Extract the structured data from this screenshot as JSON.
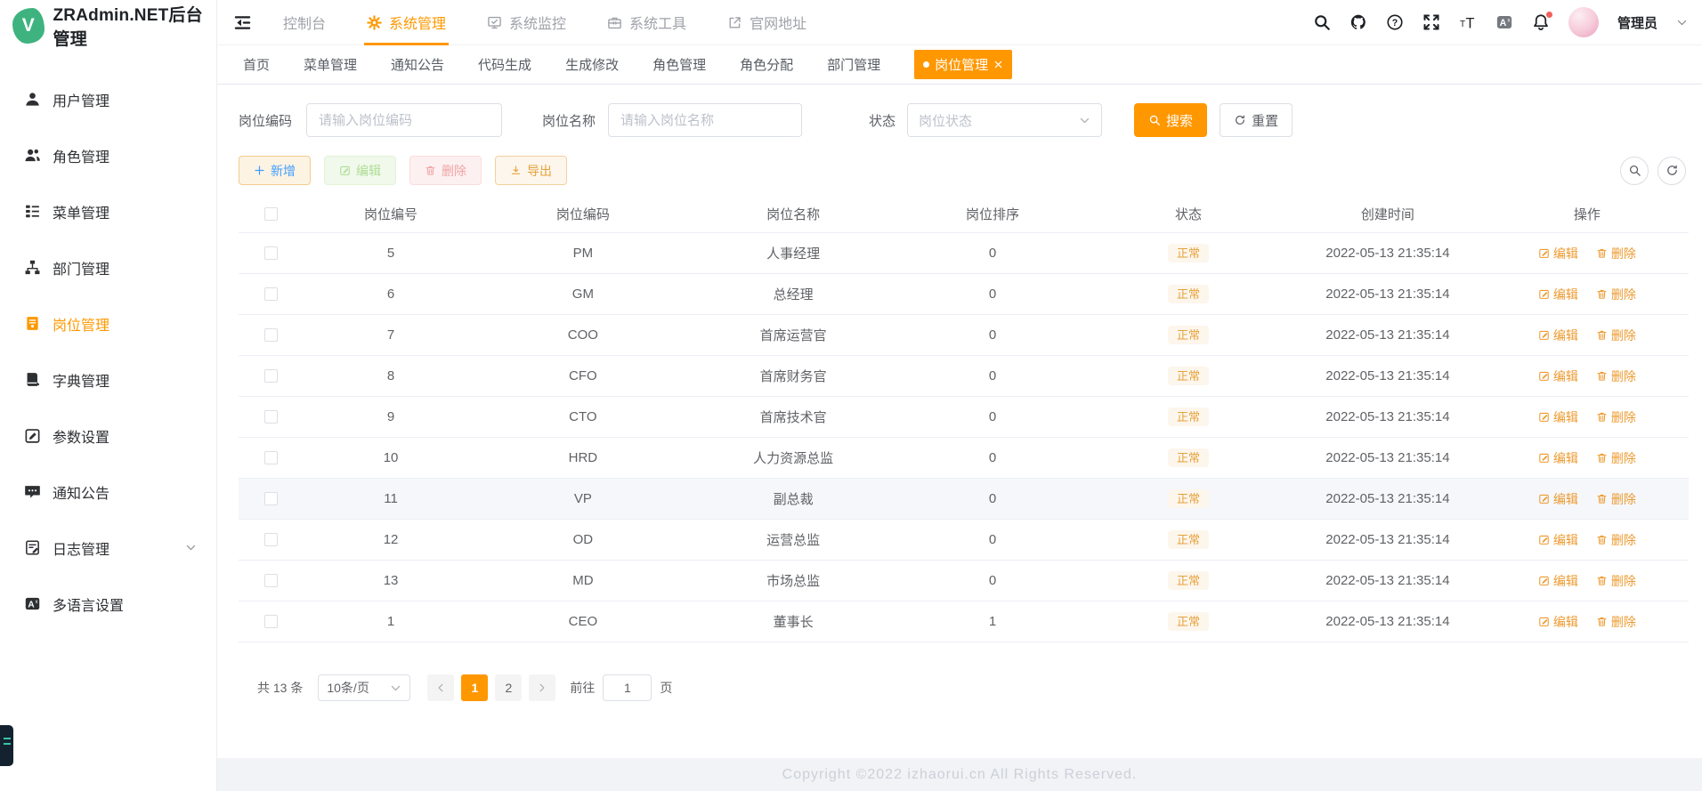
{
  "app": {
    "title": "ZRAdmin.NET后台管理",
    "username": "管理员"
  },
  "sidebar": {
    "items": [
      {
        "label": "用户管理",
        "icon": "user-icon",
        "active": false,
        "expandable": false
      },
      {
        "label": "角色管理",
        "icon": "roles-icon",
        "active": false,
        "expandable": false
      },
      {
        "label": "菜单管理",
        "icon": "menu-icon",
        "active": false,
        "expandable": false
      },
      {
        "label": "部门管理",
        "icon": "dept-icon",
        "active": false,
        "expandable": false
      },
      {
        "label": "岗位管理",
        "icon": "post-icon",
        "active": true,
        "expandable": false
      },
      {
        "label": "字典管理",
        "icon": "dict-icon",
        "active": false,
        "expandable": false
      },
      {
        "label": "参数设置",
        "icon": "params-icon",
        "active": false,
        "expandable": false
      },
      {
        "label": "通知公告",
        "icon": "notice-icon",
        "active": false,
        "expandable": false
      },
      {
        "label": "日志管理",
        "icon": "log-icon",
        "active": false,
        "expandable": true
      },
      {
        "label": "多语言设置",
        "icon": "i18n-icon",
        "active": false,
        "expandable": false
      }
    ]
  },
  "topnav": {
    "items": [
      {
        "label": "控制台",
        "icon": null,
        "active": false
      },
      {
        "label": "系统管理",
        "icon": "gear-icon",
        "active": true
      },
      {
        "label": "系统监控",
        "icon": "monitor-icon",
        "active": false
      },
      {
        "label": "系统工具",
        "icon": "toolbox-icon",
        "active": false
      },
      {
        "label": "官网地址",
        "icon": "external-link-icon",
        "active": false
      }
    ],
    "right_icons": [
      {
        "name": "search-icon",
        "badge": false
      },
      {
        "name": "github-icon",
        "badge": false
      },
      {
        "name": "help-icon",
        "badge": false
      },
      {
        "name": "fullscreen-icon",
        "badge": false
      },
      {
        "name": "font-size-icon",
        "badge": false
      },
      {
        "name": "lang-icon",
        "badge": false
      },
      {
        "name": "bell-icon",
        "badge": true
      }
    ]
  },
  "tabs": {
    "items": [
      "首页",
      "菜单管理",
      "通知公告",
      "代码生成",
      "生成修改",
      "角色管理",
      "角色分配",
      "部门管理"
    ],
    "active": "岗位管理"
  },
  "filters": {
    "code_label": "岗位编码",
    "code_placeholder": "请输入岗位编码",
    "name_label": "岗位名称",
    "name_placeholder": "请输入岗位名称",
    "status_label": "状态",
    "status_placeholder": "岗位状态",
    "search_label": "搜索",
    "reset_label": "重置"
  },
  "toolbar": {
    "add": "新增",
    "edit": "编辑",
    "delete": "删除",
    "export": "导出"
  },
  "table": {
    "headers": [
      "岗位编号",
      "岗位编码",
      "岗位名称",
      "岗位排序",
      "状态",
      "创建时间",
      "操作"
    ],
    "edit_action": "编辑",
    "delete_action": "删除",
    "rows": [
      {
        "id": "5",
        "code": "PM",
        "name": "人事经理",
        "sort": "0",
        "status": "正常",
        "created": "2022-05-13 21:35:14",
        "highlighted": false
      },
      {
        "id": "6",
        "code": "GM",
        "name": "总经理",
        "sort": "0",
        "status": "正常",
        "created": "2022-05-13 21:35:14",
        "highlighted": false
      },
      {
        "id": "7",
        "code": "COO",
        "name": "首席运营官",
        "sort": "0",
        "status": "正常",
        "created": "2022-05-13 21:35:14",
        "highlighted": false
      },
      {
        "id": "8",
        "code": "CFO",
        "name": "首席财务官",
        "sort": "0",
        "status": "正常",
        "created": "2022-05-13 21:35:14",
        "highlighted": false
      },
      {
        "id": "9",
        "code": "CTO",
        "name": "首席技术官",
        "sort": "0",
        "status": "正常",
        "created": "2022-05-13 21:35:14",
        "highlighted": false
      },
      {
        "id": "10",
        "code": "HRD",
        "name": "人力资源总监",
        "sort": "0",
        "status": "正常",
        "created": "2022-05-13 21:35:14",
        "highlighted": false
      },
      {
        "id": "11",
        "code": "VP",
        "name": "副总裁",
        "sort": "0",
        "status": "正常",
        "created": "2022-05-13 21:35:14",
        "highlighted": true
      },
      {
        "id": "12",
        "code": "OD",
        "name": "运营总监",
        "sort": "0",
        "status": "正常",
        "created": "2022-05-13 21:35:14",
        "highlighted": false
      },
      {
        "id": "13",
        "code": "MD",
        "name": "市场总监",
        "sort": "0",
        "status": "正常",
        "created": "2022-05-13 21:35:14",
        "highlighted": false
      },
      {
        "id": "1",
        "code": "CEO",
        "name": "董事长",
        "sort": "1",
        "status": "正常",
        "created": "2022-05-13 21:35:14",
        "highlighted": false
      }
    ]
  },
  "pagination": {
    "total": "共 13 条",
    "page_size": "10条/页",
    "pages": [
      "1",
      "2"
    ],
    "active": "1",
    "goto": "前往",
    "goto_value": "1",
    "unit": "页"
  },
  "footer": {
    "copyright": "Copyright ©2022 izhaorui.cn All Rights Reserved."
  },
  "colors": {
    "theme": "#ff9700",
    "sidebar_active": "#ff9800",
    "link": "#ed9a2e",
    "badge_text": "#e6a23c",
    "badge_bg": "#fdf6ec",
    "logo_green": "#3eb37f"
  }
}
